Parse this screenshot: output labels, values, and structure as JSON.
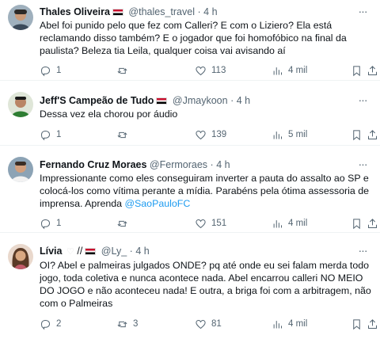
{
  "tweets": [
    {
      "name": "Thales Oliveira",
      "handle": "@thales_travel",
      "dot": "·",
      "time": "4 h",
      "text": "Abel foi punido pelo que fez com Calleri? E com o Liziero? Ela está reclamando disso também? E o jogador que foi homofóbico na final da paulista? Beleza tia Leila, qualquer coisa vai avisando aí",
      "link": "",
      "replies": "1",
      "retweets": "",
      "likes": "113",
      "views": "4 mil"
    },
    {
      "name": "Jeff'S Campeão de Tudo",
      "handle": "@Jmaykoon",
      "dot": "·",
      "time": "4 h",
      "text": "Dessa vez ela chorou por áudio",
      "link": "",
      "replies": "1",
      "retweets": "",
      "likes": "139",
      "views": "5 mil"
    },
    {
      "name": "Fernando Cruz Moraes",
      "handle": "@Fermoraes",
      "dot": "·",
      "time": "4 h",
      "text": "Impressionante como eles conseguiram inverter a pauta do assalto ao SP e colocá-los como vítima perante a mídia. Parabéns pela ótima assessoria de imprensa. Aprenda ",
      "link": "@SaoPauloFC",
      "replies": "1",
      "retweets": "",
      "likes": "151",
      "views": "4 mil"
    },
    {
      "name": "Lívia",
      "handle": "@Ly_",
      "dot": "·",
      "time": "4 h",
      "name_suffix": "//",
      "text": "OI? Abel e palmeiras julgados ONDE? pq até onde eu sei falam merda todo jogo, toda coletiva e nunca acontece nada. Abel encarrou calleri NO MEIO DO JOGO e não aconteceu nada! E outra, a briga foi com a arbitragem, não com o Palmeiras",
      "link": "",
      "replies": "2",
      "retweets": "3",
      "likes": "81",
      "views": "4 mil"
    }
  ],
  "icons": {
    "reply": "reply-icon",
    "retweet": "retweet-icon",
    "like": "heart-icon",
    "views": "views-chart-icon",
    "bookmark": "bookmark-icon",
    "share": "share-icon",
    "more": "more-options-icon"
  },
  "colors": {
    "text": "#0f1419",
    "secondary": "#536471",
    "link": "#1d9bf0",
    "divider": "#eff3f4"
  }
}
